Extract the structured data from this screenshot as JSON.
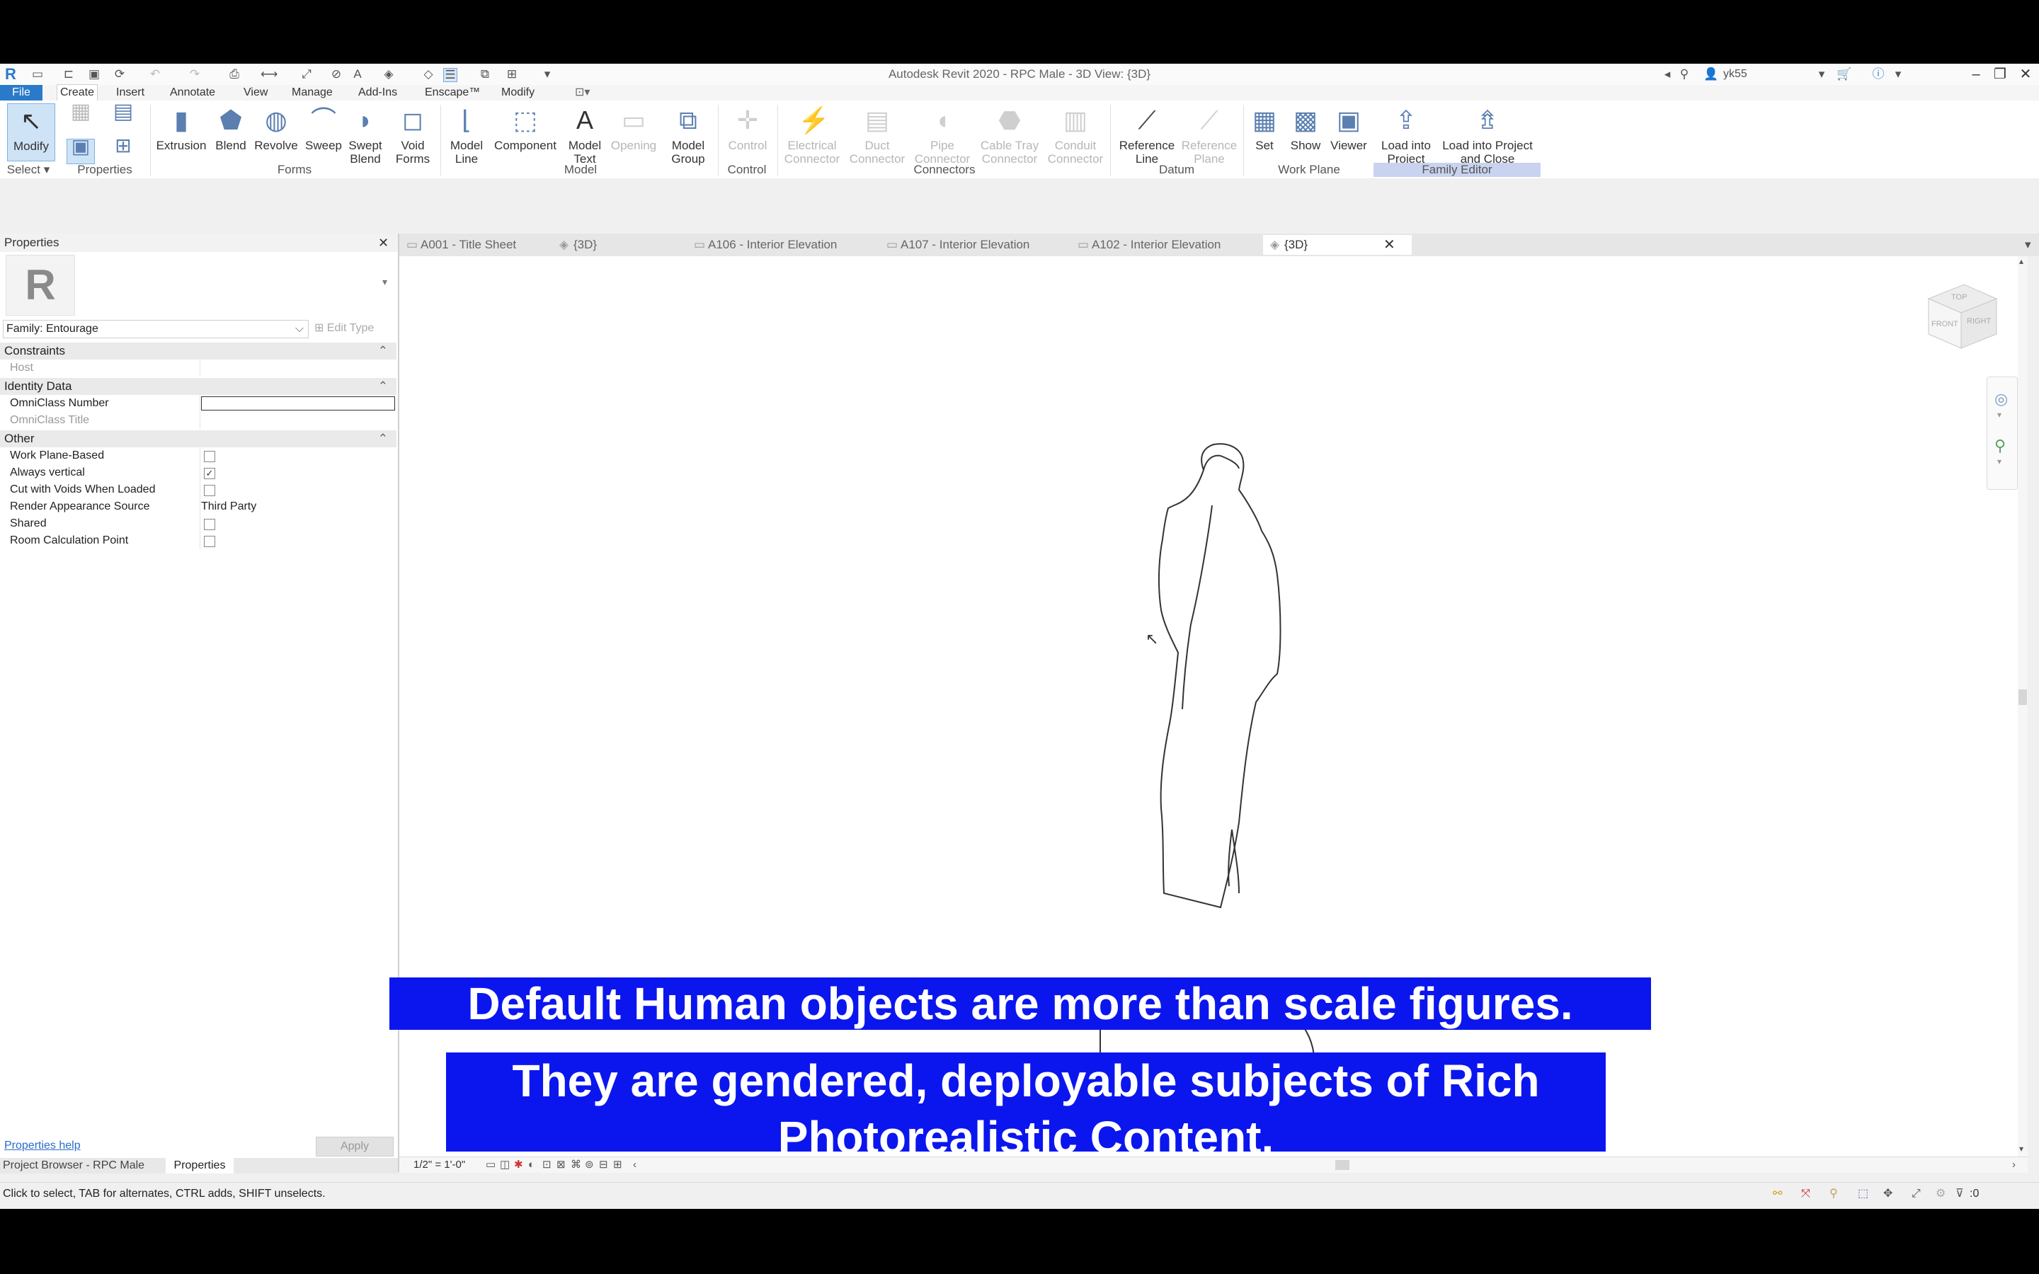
{
  "app": {
    "title": "Autodesk Revit 2020 - RPC Male - 3D View: {3D}",
    "user": "yk55"
  },
  "ribbon": {
    "tabs": [
      "File",
      "Create",
      "Insert",
      "Annotate",
      "View",
      "Manage",
      "Add-Ins",
      "Enscape™",
      "Modify"
    ],
    "select_label": "Select",
    "buttons": {
      "modify": "Modify",
      "extrusion": "Extrusion",
      "blend": "Blend",
      "revolve": "Revolve",
      "sweep": "Sweep",
      "swept_blend": "Swept Blend",
      "void_forms": "Void Forms",
      "model_line": "Model Line",
      "component": "Component",
      "model_text": "Model Text",
      "opening": "Opening",
      "model_group": "Model Group",
      "control": "Control",
      "electrical_connector": "Electrical Connector",
      "duct_connector": "Duct Connector",
      "pipe_connector": "Pipe Connector",
      "cable_tray_connector": "Cable Tray Connector",
      "conduit_connector": "Conduit Connector",
      "reference_line": "Reference Line",
      "reference_plane": "Reference Plane",
      "set": "Set",
      "show": "Show",
      "viewer": "Viewer",
      "load_into_project": "Load into Project",
      "load_into_project_close": "Load into Project and Close"
    },
    "panels": {
      "properties": "Properties",
      "forms": "Forms",
      "model": "Model",
      "control": "Control",
      "connectors": "Connectors",
      "datum": "Datum",
      "work_plane": "Work Plane",
      "family_editor": "Family Editor"
    }
  },
  "view_tabs": [
    "A001 - Title Sheet",
    "{3D}",
    "A106 - Interior Elevation",
    "A107 - Interior Elevation",
    "A102 - Interior Elevation",
    "{3D}"
  ],
  "properties": {
    "title": "Properties",
    "type_selector": "Family: Entourage",
    "edit_type": "Edit Type",
    "groups": {
      "constraints": "Constraints",
      "identity": "Identity Data",
      "other": "Other"
    },
    "rows": {
      "host": "Host",
      "omniclass_number": "OmniClass Number",
      "omniclass_title": "OmniClass Title",
      "work_plane_based": "Work Plane-Based",
      "always_vertical": "Always vertical",
      "cut_with_voids": "Cut with Voids When Loaded",
      "render_appearance": "Render Appearance Source",
      "render_appearance_value": "Third Party",
      "shared": "Shared",
      "room_calc": "Room Calculation Point"
    },
    "always_vertical_checked": "✓",
    "help": "Properties help",
    "apply": "Apply"
  },
  "browser_tabs": {
    "project_browser": "Project Browser - RPC Male",
    "properties": "Properties"
  },
  "view_control": {
    "scale": "1/2\" = 1'-0\""
  },
  "status": {
    "message": "Click to select, TAB for alternates, CTRL adds, SHIFT unselects.",
    "filter_count": ":0"
  },
  "viewcube": {
    "front": "FRONT",
    "right": "RIGHT",
    "top": "TOP"
  },
  "captions": {
    "line1": "Default Human objects are more than scale figures.",
    "line2": "They are gendered, deployable subjects of Rich",
    "line3": "Photorealistic Content."
  }
}
